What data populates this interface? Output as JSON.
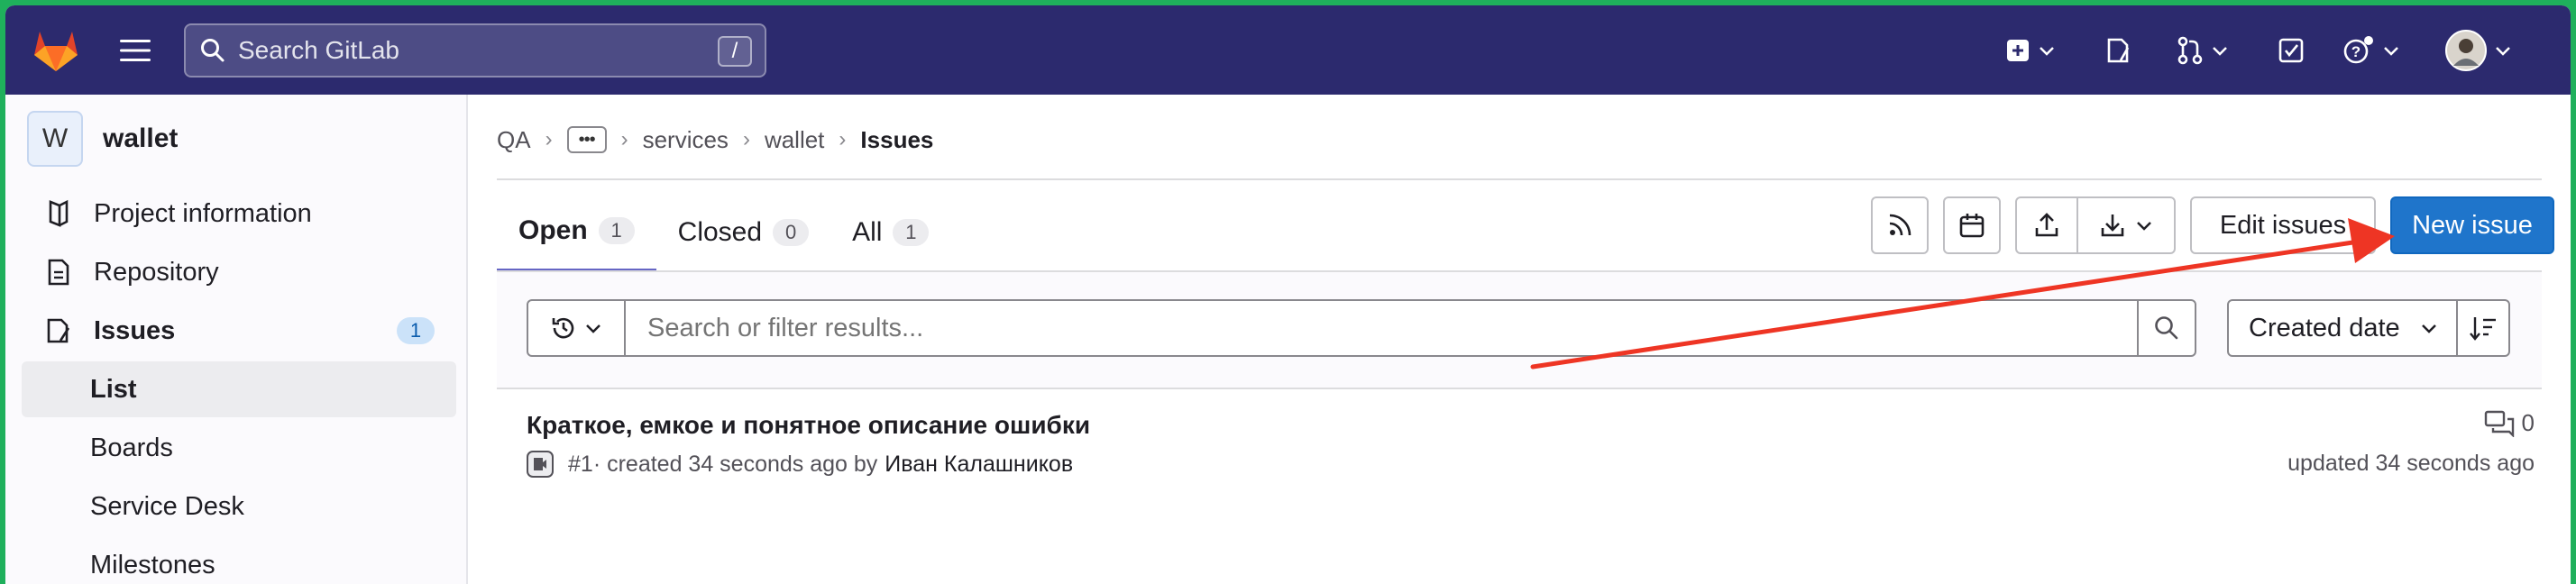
{
  "navbar": {
    "search_placeholder": "Search GitLab",
    "search_shortcut": "/"
  },
  "sidebar": {
    "project_initial": "W",
    "project_name": "wallet",
    "items": [
      {
        "label": "Project information",
        "icon": "project-info-icon"
      },
      {
        "label": "Repository",
        "icon": "repository-icon"
      },
      {
        "label": "Issues",
        "icon": "issues-icon",
        "badge": "1"
      },
      {
        "label": "List"
      },
      {
        "label": "Boards"
      },
      {
        "label": "Service Desk"
      },
      {
        "label": "Milestones"
      }
    ]
  },
  "breadcrumb": {
    "root": "QA",
    "more": "•••",
    "group": "services",
    "project": "wallet",
    "current": "Issues"
  },
  "tabs": [
    {
      "label": "Open",
      "count": "1"
    },
    {
      "label": "Closed",
      "count": "0"
    },
    {
      "label": "All",
      "count": "1"
    }
  ],
  "actions": {
    "edit_issues": "Edit issues",
    "new_issue": "New issue"
  },
  "filter": {
    "placeholder": "Search or filter results...",
    "sort_label": "Created date"
  },
  "issue": {
    "title": "Краткое, емкое и понятное описание ошибки",
    "ref": "#1",
    "created": " · created 34 seconds ago by",
    "author": "Иван Калашников",
    "comments": "0",
    "updated": "updated 34 seconds ago"
  },
  "colors": {
    "navbar": "#2c2a6e",
    "primary": "#1f75cb",
    "annotation_arrow": "#ee3524",
    "frame_border": "#1fb05c"
  }
}
